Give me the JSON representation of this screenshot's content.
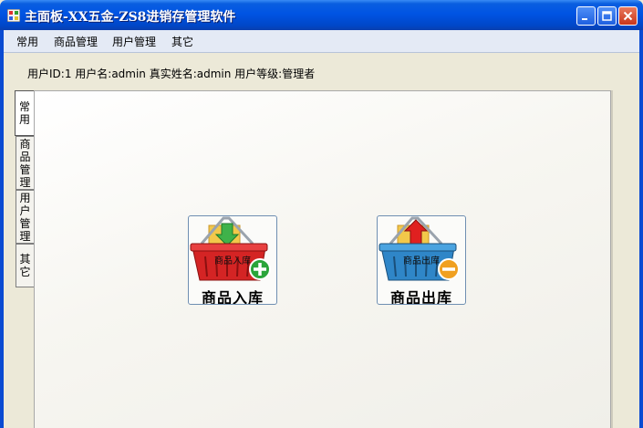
{
  "window": {
    "title": "主面板-XX五金-ZS8进销存管理软件"
  },
  "menu": {
    "items": [
      "常用",
      "商品管理",
      "用户管理",
      "其它"
    ]
  },
  "user_info": "用户ID:1 用户名:admin 真实姓名:admin 用户等级:管理者",
  "tabs": [
    "常用",
    "商品管理",
    "用户管理",
    "其它"
  ],
  "tiles": {
    "stock_in": {
      "caption": "商品入库",
      "overlay": "商品入库",
      "icon": "basket-plus-icon"
    },
    "stock_out": {
      "caption": "商品出库",
      "overlay": "商品出库",
      "icon": "basket-minus-icon"
    }
  },
  "colors": {
    "titlebar": "#0054e3",
    "stock_in_basket": "#d42424",
    "stock_out_basket": "#2f86c8",
    "plus_badge": "#2aa53a",
    "minus_badge": "#f0a020"
  }
}
